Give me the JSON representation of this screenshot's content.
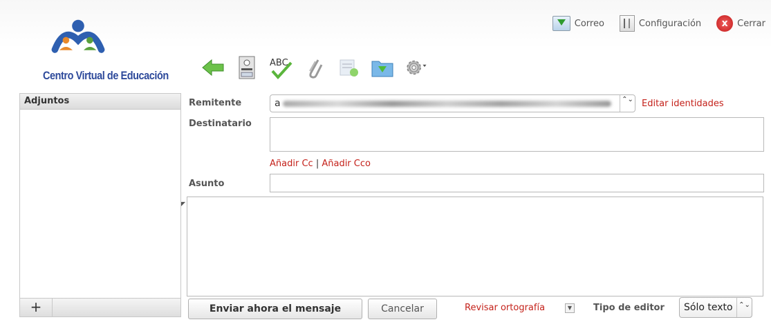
{
  "top_nav": {
    "mail_label": "Correo",
    "config_label": "Configuración",
    "close_label": "Cerrar",
    "close_glyph": "x"
  },
  "logo": {
    "text": "Centro Virtual de Educación",
    "colors": {
      "blue": "#2e5fb0",
      "orange": "#e8892b",
      "green": "#5aa03c"
    }
  },
  "toolbar": {
    "icons": [
      "back-arrow-icon",
      "address-book-icon",
      "spellcheck-icon",
      "attachment-icon",
      "signature-icon",
      "save-draft-icon",
      "settings-gear-icon"
    ],
    "spell_text": "ABC"
  },
  "attachments": {
    "header": "Adjuntos",
    "add_label": "+"
  },
  "compose": {
    "from_label": "Remitente",
    "from_value": "a",
    "edit_identities": "Editar identidades",
    "to_label": "Destinatario",
    "add_cc": "Añadir Cc",
    "link_separator": "|",
    "add_bcc": "Añadir Cco",
    "subject_label": "Asunto",
    "updown_glyph": "⌃⌄"
  },
  "footer": {
    "send_label": "Enviar ahora el mensaje",
    "cancel_label": "Cancelar",
    "spellcheck_label": "Revisar ortografía",
    "editor_type_label": "Tipo de editor",
    "editor_type_value": "Sólo texto"
  },
  "colors": {
    "link_red": "#c4211a",
    "label_gray": "#555555"
  }
}
